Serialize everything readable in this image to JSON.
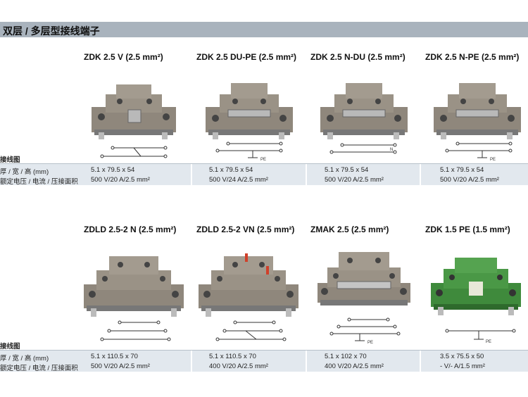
{
  "header": {
    "title": "双层 / 多层型接线端子"
  },
  "row_labels": {
    "wiring": "接线图",
    "dimensions": "厚 / 宽 / 高 (mm)",
    "rating": "额定电压 / 电流 / 压接面积"
  },
  "products_row1": [
    {
      "name": "ZDK 2.5 V (2.5 mm²)",
      "dim": "5.1 x 79.5 x 54",
      "rating": "500 V/20 A/2.5 mm²"
    },
    {
      "name": "ZDK 2.5 DU-PE (2.5 mm²)",
      "dim": "5.1 x 79.5 x 54",
      "rating": "500 V/24 A/2.5 mm²"
    },
    {
      "name": "ZDK 2.5 N-DU (2.5 mm²)",
      "dim": "5.1 x 79.5 x 54",
      "rating": "500 V/20 A/2.5 mm²"
    },
    {
      "name": "ZDK 2.5 N-PE (2.5 mm²)",
      "dim": "5.1 x 79.5 x 54",
      "rating": "500 V/20 A/2.5 mm²"
    }
  ],
  "products_row2": [
    {
      "name": "ZDLD 2.5-2 N (2.5 mm²)",
      "dim": "5.1 x 110.5 x 70",
      "rating": "500 V/20 A/2.5 mm²"
    },
    {
      "name": "ZDLD 2.5-2 VN (2.5 mm²)",
      "dim": "5.1 x 110.5 x 70",
      "rating": "400 V/20 A/2.5 mm²"
    },
    {
      "name": "ZMAK 2.5 (2.5 mm²)",
      "dim": "5.1 x 102 x 70",
      "rating": "400 V/20 A/2.5 mm²"
    },
    {
      "name": "ZDK 1.5 PE (1.5 mm²)",
      "dim": "3.5 x 75.5 x 50",
      "rating": "- V/- A/1.5 mm²"
    }
  ],
  "diagram_labels": {
    "pe": "PE",
    "n": "N"
  },
  "colors": {
    "header_bg": "#a9b3bd",
    "spec_bg": "#e2e8ee",
    "terminal_grey": "#8f877c",
    "terminal_green": "#3f8a3c"
  }
}
